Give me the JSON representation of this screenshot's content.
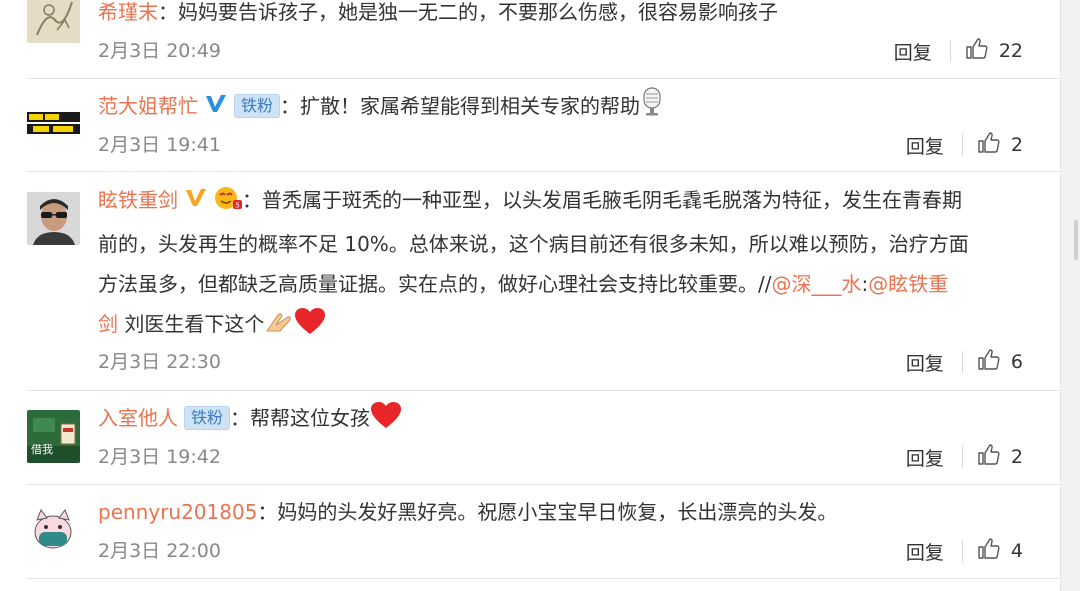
{
  "comments": [
    {
      "username": "希瑾末",
      "text": "：妈妈要告诉孩子，她是独一无二的，不要那么伤感，很容易影响孩子",
      "date": "2月3日 20:49",
      "reply_label": "回复",
      "likes": "22"
    },
    {
      "username": "范大姐帮忙",
      "badge": "铁粉",
      "text": "：扩散！家属希望能得到相关专家的帮助",
      "date": "2月3日 19:41",
      "reply_label": "回复",
      "likes": "2"
    },
    {
      "username": "眩铁重剑",
      "lines": [
        "：普秃属于斑秃的一种亚型，以头发眉毛腋毛阴毛毳毛脱落为特征，发生在青春期",
        "前的，头发再生的概率不足 10%。总体来说，这个病目前还有很多未知，所以难以预防，治疗方面",
        "方法虽多，但都缺乏高质量证据。实在点的，做好心理社会支持比较重要。//"
      ],
      "mention1": "@深___水",
      "colon": ":",
      "mention2_part1": "@眩铁重",
      "mention2_part2": "剑",
      "tail": " 刘医生看下这个",
      "date": "2月3日 22:30",
      "reply_label": "回复",
      "likes": "6"
    },
    {
      "username": "入室他人",
      "badge": "铁粉",
      "text": "：帮帮这位女孩",
      "avatar_text": "借我",
      "date": "2月3日 19:42",
      "reply_label": "回复",
      "likes": "2"
    },
    {
      "username": "pennyru201805",
      "text": "：妈妈的头发好黑好亮。祝愿小宝宝早日恢复，长出漂亮的头发。",
      "date": "2月3日 22:00",
      "reply_label": "回复",
      "likes": "4"
    }
  ],
  "colors": {
    "username": "#eb7350",
    "meta": "#888888",
    "badge_bg": "#cfe3f5",
    "heart": "#e8262a"
  }
}
